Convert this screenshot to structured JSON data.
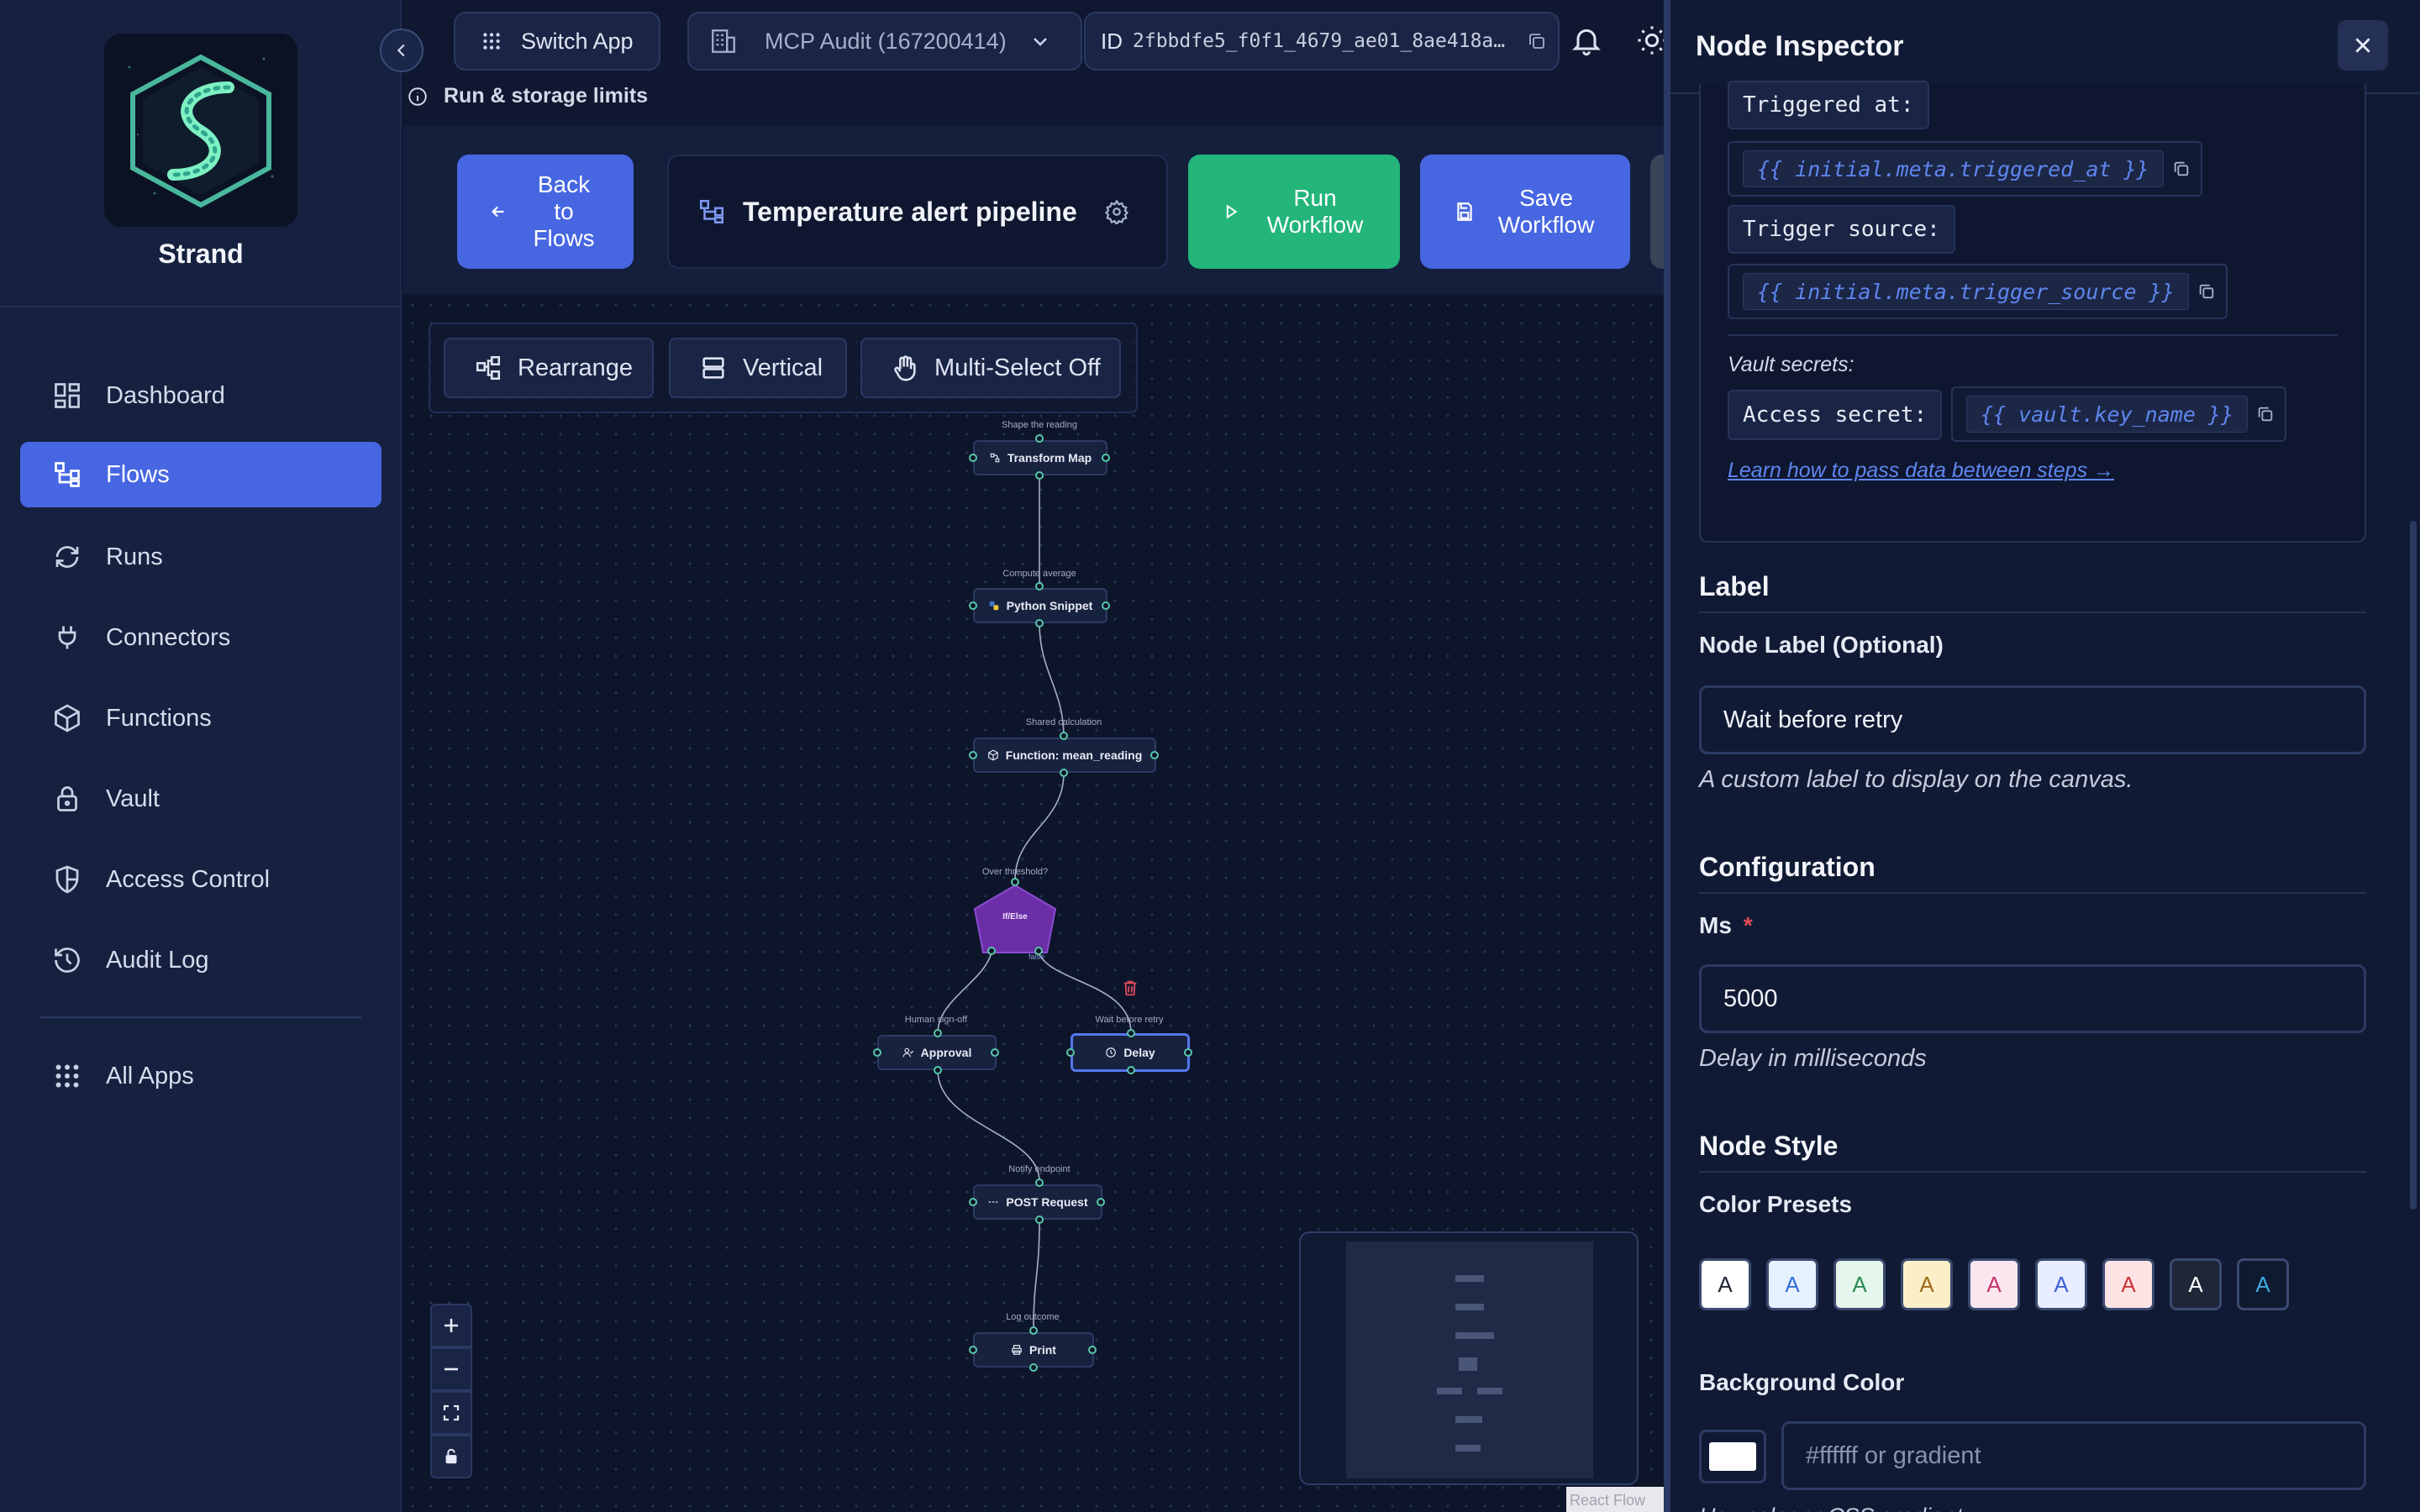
{
  "app": {
    "brand": "Strand"
  },
  "sidebar": {
    "items": [
      {
        "label": "Dashboard",
        "icon": "dashboard-icon",
        "active": false
      },
      {
        "label": "Flows",
        "icon": "flows-icon",
        "active": true
      },
      {
        "label": "Runs",
        "icon": "runs-icon",
        "active": false
      },
      {
        "label": "Connectors",
        "icon": "plug-icon",
        "active": false
      },
      {
        "label": "Functions",
        "icon": "cube-icon",
        "active": false
      },
      {
        "label": "Vault",
        "icon": "lock-icon",
        "active": false
      },
      {
        "label": "Access Control",
        "icon": "shield-icon",
        "active": false
      },
      {
        "label": "Audit Log",
        "icon": "history-icon",
        "active": false
      }
    ],
    "all_apps": "All Apps"
  },
  "topbar": {
    "switch_app": "Switch App",
    "tenant": "MCP Audit (167200414)",
    "id_prefix": "ID",
    "id_value": "2fbbdfe5_f0f1_4679_ae01_8ae418a…",
    "run_limits": "Run & storage limits"
  },
  "flow_header": {
    "back": "Back to Flows",
    "title": "Temperature alert pipeline",
    "run": "Run Workflow",
    "save": "Save Workflow"
  },
  "toolbar": {
    "rearrange": "Rearrange",
    "vertical": "Vertical",
    "multiselect": "Multi-Select Off"
  },
  "canvas": {
    "nodes": [
      {
        "caption": "Shape the reading",
        "label": "Transform Map",
        "icon": "transform-icon"
      },
      {
        "caption": "Compute average",
        "label": "Python Snippet",
        "icon": "python-icon"
      },
      {
        "caption": "Shared calculation",
        "label": "Function: mean_reading",
        "icon": "cube-icon"
      },
      {
        "caption": "Over threshold?",
        "label": "If/Else",
        "icon": "branch-icon"
      },
      {
        "caption": "Human sign-off",
        "label": "Approval",
        "icon": "user-check-icon"
      },
      {
        "caption": "Wait before retry",
        "label": "Delay",
        "icon": "clock-icon"
      },
      {
        "caption": "Notify endpoint",
        "label": "POST Request",
        "icon": "request-icon"
      },
      {
        "caption": "Log outcome",
        "label": "Print",
        "icon": "printer-icon"
      }
    ],
    "branch_false_label": "false",
    "attribution": "React Flow"
  },
  "inspector": {
    "title": "Node Inspector",
    "vars": {
      "triggered_at_label": "Triggered at:",
      "triggered_at_value": "{{ initial.meta.triggered_at }}",
      "trigger_source_label": "Trigger source:",
      "trigger_source_value": "{{ initial.meta.trigger_source }}",
      "vault_heading": "Vault secrets:",
      "access_secret_label": "Access secret:",
      "access_secret_value": "{{ vault.key_name }}",
      "learn_link": "Learn how to pass data between steps →"
    },
    "label_section": {
      "heading": "Label",
      "field_label": "Node Label (Optional)",
      "value": "Wait before retry",
      "hint": "A custom label to display on the canvas."
    },
    "config_section": {
      "heading": "Configuration",
      "field_label": "Ms",
      "required_mark": "*",
      "value": "5000",
      "hint": "Delay in milliseconds"
    },
    "style_section": {
      "heading": "Node Style",
      "presets_label": "Color Presets",
      "preset_letter": "A",
      "presets": [
        {
          "bg": "#ffffff",
          "fg": "#1e2433"
        },
        {
          "bg": "#e6f1ff",
          "fg": "#2f6fd8"
        },
        {
          "bg": "#e5f6ec",
          "fg": "#2a8a4f"
        },
        {
          "bg": "#fbefc8",
          "fg": "#a06a13"
        },
        {
          "bg": "#fbe6ef",
          "fg": "#c3356a"
        },
        {
          "bg": "#e8eeff",
          "fg": "#3f5ed8"
        },
        {
          "bg": "#fde3e3",
          "fg": "#c8353a"
        },
        {
          "bg": "#1f2638",
          "fg": "#ffffff"
        },
        {
          "bg": "#0e1a2f",
          "fg": "#3fa9e0"
        }
      ],
      "bg_label": "Background Color",
      "bg_placeholder": "#ffffff or gradient",
      "bg_swatch": "#ffffff",
      "bg_hint": "Hex color or CSS gradient"
    }
  }
}
